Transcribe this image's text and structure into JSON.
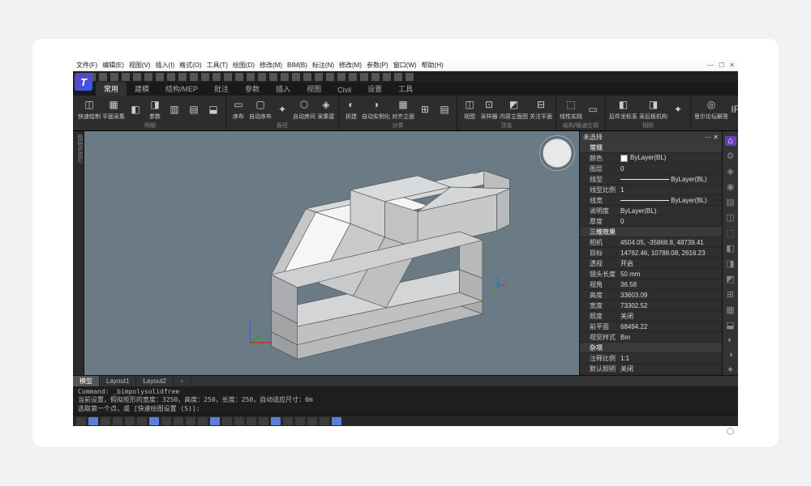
{
  "menu": {
    "items": [
      "文件(F)",
      "编辑(E)",
      "视图(V)",
      "插入(I)",
      "格式(O)",
      "工具(T)",
      "绘图(D)",
      "修改(M)",
      "BIM(B)",
      "标注(N)",
      "修改(M)",
      "参数(P)",
      "窗口(W)",
      "帮助(H)"
    ]
  },
  "quick_count": 30,
  "tabs": {
    "items": [
      "常用",
      "建模",
      "结构/MEP",
      "批注",
      "参数",
      "插入",
      "视图",
      "Civil",
      "设置",
      "工具"
    ],
    "active_index": 0
  },
  "ribbon_groups": [
    {
      "label": "明细",
      "buttons": [
        {
          "icon": "◫",
          "text": "快速绘制"
        },
        {
          "icon": "▦",
          "text": "平面采集"
        },
        {
          "icon": "◧",
          "text": ""
        },
        {
          "icon": "◨",
          "text": "参数"
        },
        {
          "icon": "▥",
          "text": ""
        },
        {
          "icon": "▤",
          "text": ""
        },
        {
          "icon": "⬓",
          "text": ""
        }
      ]
    },
    {
      "label": "板坯",
      "buttons": [
        {
          "icon": "▭",
          "text": "序布"
        },
        {
          "icon": "▢",
          "text": "自动序布"
        },
        {
          "icon": "✦",
          "text": ""
        },
        {
          "icon": "⬡",
          "text": "自动房间"
        },
        {
          "icon": "◈",
          "text": "采集屋"
        }
      ]
    },
    {
      "label": "分类",
      "buttons": [
        {
          "icon": "◐",
          "text": "拆建"
        },
        {
          "icon": "◑",
          "text": "自动实例化"
        },
        {
          "icon": "▦",
          "text": "对齐立面"
        },
        {
          "icon": "⊞",
          "text": ""
        },
        {
          "icon": "▤",
          "text": ""
        }
      ]
    },
    {
      "label": "顶盖",
      "buttons": [
        {
          "icon": "◫",
          "text": "视图"
        },
        {
          "icon": "⊡",
          "text": "采样器"
        },
        {
          "icon": "◩",
          "text": "内容立面图"
        },
        {
          "icon": "⊟",
          "text": "关注平面"
        }
      ]
    },
    {
      "label": "结构/暖通空调",
      "buttons": [
        {
          "icon": "⬚",
          "text": "线性实践"
        },
        {
          "icon": "▭",
          "text": ""
        }
      ]
    },
    {
      "label": "相同",
      "buttons": [
        {
          "icon": "◧",
          "text": "后件坐标系"
        },
        {
          "icon": "◨",
          "text": "采后板机构"
        },
        {
          "icon": "✦",
          "text": ""
        }
      ]
    },
    {
      "label": "",
      "buttons": [
        {
          "icon": "◎",
          "text": "思尔论坛解答"
        },
        {
          "icon": "IFC",
          "text": ""
        },
        {
          "icon": "⊡",
          "text": ""
        }
      ]
    }
  ],
  "left_strip": "图层状态栏",
  "props": {
    "title": "未选择",
    "rows": [
      {
        "cat": true,
        "label": "常规"
      },
      {
        "label": "颜色",
        "val": "◻ ByLayer(BL)"
      },
      {
        "label": "图层",
        "val": "0"
      },
      {
        "label": "线型",
        "val": "— ByLayer(BL)"
      },
      {
        "label": "线型比例",
        "val": "1"
      },
      {
        "label": "线宽",
        "val": "——— ByLayer(BL)"
      },
      {
        "label": "说明度",
        "val": "ByLayer(BL)"
      },
      {
        "label": "厚度",
        "val": "0"
      },
      {
        "cat": true,
        "label": "三维效果"
      },
      {
        "label": "相机",
        "val": "4504.05, -35868.8, 48739.41"
      },
      {
        "label": "目标",
        "val": "14762.46, 10788.08, 2616.23"
      },
      {
        "label": "透视",
        "val": "开启"
      },
      {
        "label": "镜头长度",
        "val": "50 mm"
      },
      {
        "label": "视角",
        "val": "36.58"
      },
      {
        "label": "高度",
        "val": "33603.09"
      },
      {
        "label": "宽度",
        "val": "73302.52"
      },
      {
        "label": "照度",
        "val": "关闭"
      },
      {
        "label": "前平面",
        "val": "68494.22"
      },
      {
        "label": "视觉样式",
        "val": "Bm"
      },
      {
        "cat": true,
        "label": "杂项"
      },
      {
        "label": "注释比例",
        "val": "1:1"
      },
      {
        "label": "默认照明",
        "val": "关闭"
      }
    ]
  },
  "rail_icons": [
    "⌂",
    "⚙",
    "◈",
    "◉",
    "▤",
    "◫",
    "⬚",
    "◧",
    "◨",
    "◩",
    "⊞",
    "▦",
    "⬓",
    "◐",
    "◑",
    "✦",
    "⊡",
    "◎",
    "▭",
    "⬡"
  ],
  "layout_tabs": {
    "items": [
      "模型",
      "Layout1",
      "Layout2"
    ],
    "active": 0
  },
  "cmd": {
    "line1": "Command: _bimpolysolidfree",
    "line2": "当前设置，假拟矩形的宽度：3250，高度：250，长度：250，自动适应尺寸：0m",
    "line3": "选取第一个点，或 [快速绘图设置 (S)]:"
  },
  "status_count": 22
}
